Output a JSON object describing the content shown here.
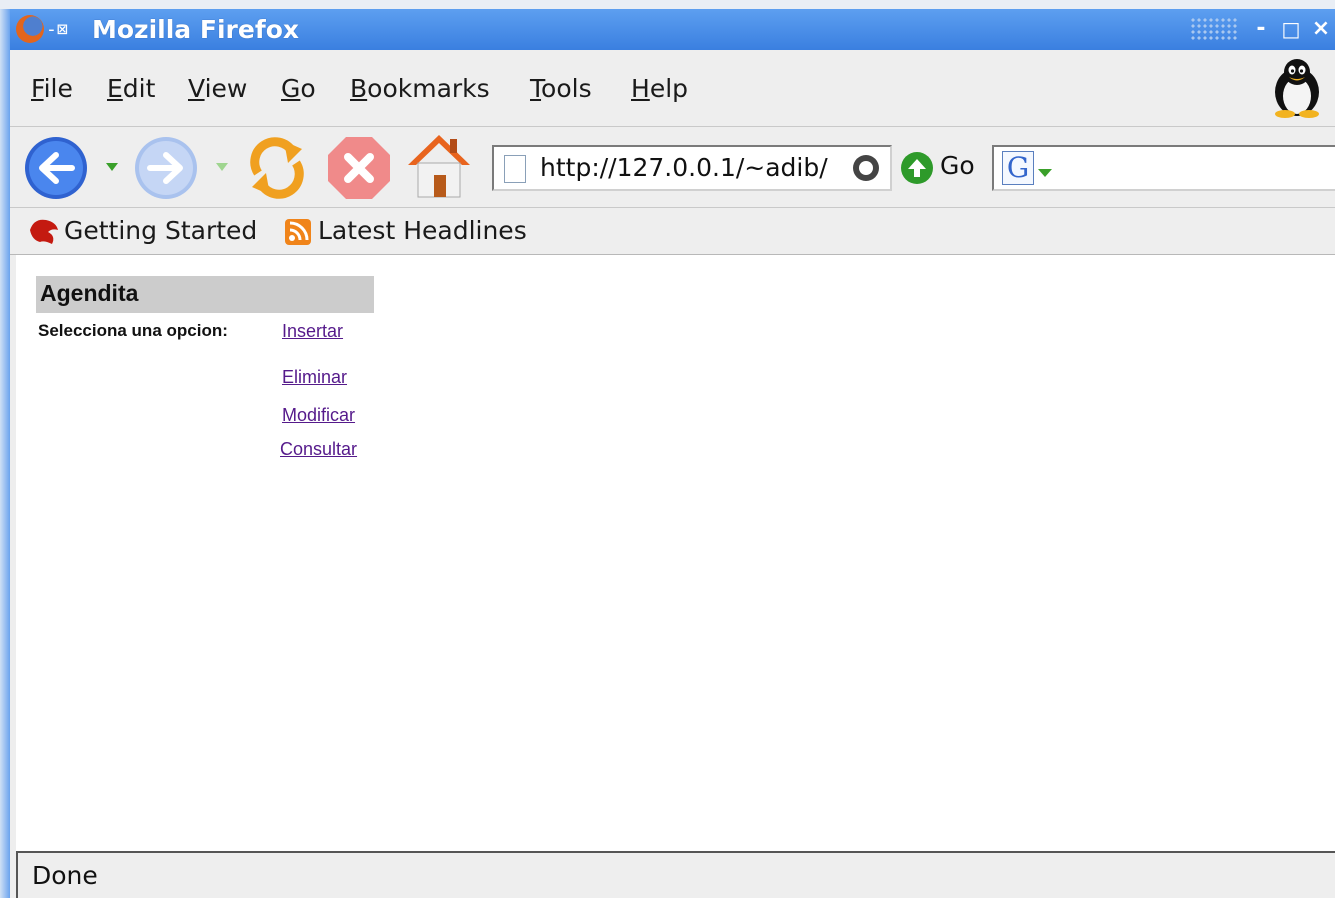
{
  "window": {
    "title": "Mozilla Firefox",
    "controls": [
      "-",
      "□",
      "×"
    ]
  },
  "menubar": {
    "items": [
      {
        "label": "File",
        "mnemonic": "F",
        "rest": "ile"
      },
      {
        "label": "Edit",
        "mnemonic": "E",
        "rest": "dit"
      },
      {
        "label": "View",
        "mnemonic": "V",
        "rest": "iew"
      },
      {
        "label": "Go",
        "mnemonic": "G",
        "rest": "o"
      },
      {
        "label": "Bookmarks",
        "mnemonic": "B",
        "rest": "ookmarks"
      },
      {
        "label": "Tools",
        "mnemonic": "T",
        "rest": "ools"
      },
      {
        "label": "Help",
        "mnemonic": "H",
        "rest": "elp"
      }
    ]
  },
  "navbar": {
    "url": "http://127.0.0.1/~adib/",
    "go_label": "Go",
    "icons": [
      "back-icon",
      "forward-icon",
      "reload-icon",
      "stop-icon",
      "home-icon"
    ],
    "search_engine": "G"
  },
  "bookmarks": {
    "items": [
      {
        "label": "Getting Started",
        "icon": "firefox-bookmark-icon"
      },
      {
        "label": "Latest Headlines",
        "icon": "rss-icon"
      }
    ]
  },
  "page": {
    "title": "Agendita",
    "prompt": "Selecciona una opcion:",
    "options": [
      "Insertar",
      "Eliminar",
      "Modificar",
      "Consultar"
    ],
    "link_color": "#551a8b"
  },
  "status": {
    "text": "Done"
  }
}
